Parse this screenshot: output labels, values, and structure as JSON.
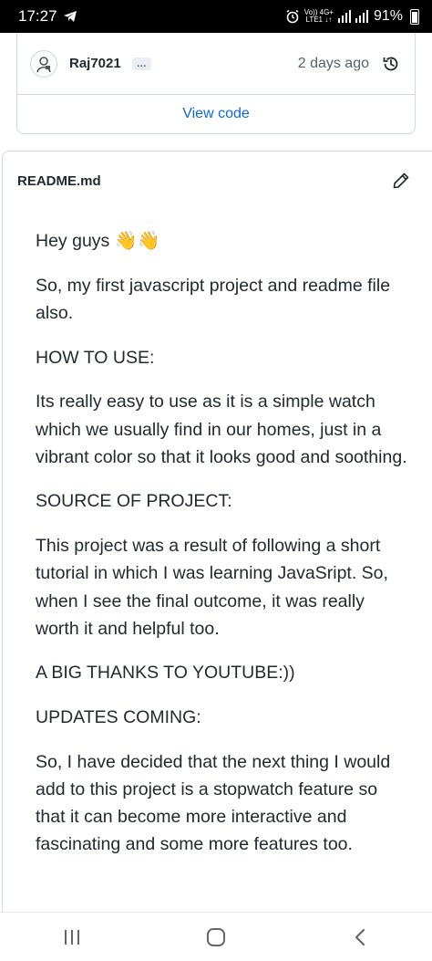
{
  "status_bar": {
    "time": "17:27",
    "signal_top": "Vo)) 4G+",
    "signal_bottom": "LTE1 ↓↑",
    "battery": "91%"
  },
  "commit": {
    "username": "Raj7021",
    "more_label": "…",
    "time_ago": "2 days ago",
    "view_code_label": "View code"
  },
  "readme": {
    "filename": "README.md",
    "paragraphs": [
      "Hey guys",
      "So, my first javascript project and readme file also.",
      "HOW TO USE:",
      "Its really easy to use as it is a simple watch which we usually find in our homes, just in a vibrant color so that it looks good and soothing.",
      "SOURCE OF PROJECT:",
      "This project was a result of following a short tutorial in which I was learning JavaSript. So, when I see the final outcome, it was really worth it and helpful too.",
      "A BIG THANKS TO YOUTUBE:))",
      "UPDATES COMING:",
      "So, I have decided that the next thing I would add to this project is a stopwatch feature so that it can become more interactive and fascinating and some more features too."
    ],
    "greeting_emoji": "👋👋"
  },
  "navigation": {
    "recents_icon": "recents-icon",
    "home_icon": "home-icon",
    "back_icon": "back-icon"
  }
}
